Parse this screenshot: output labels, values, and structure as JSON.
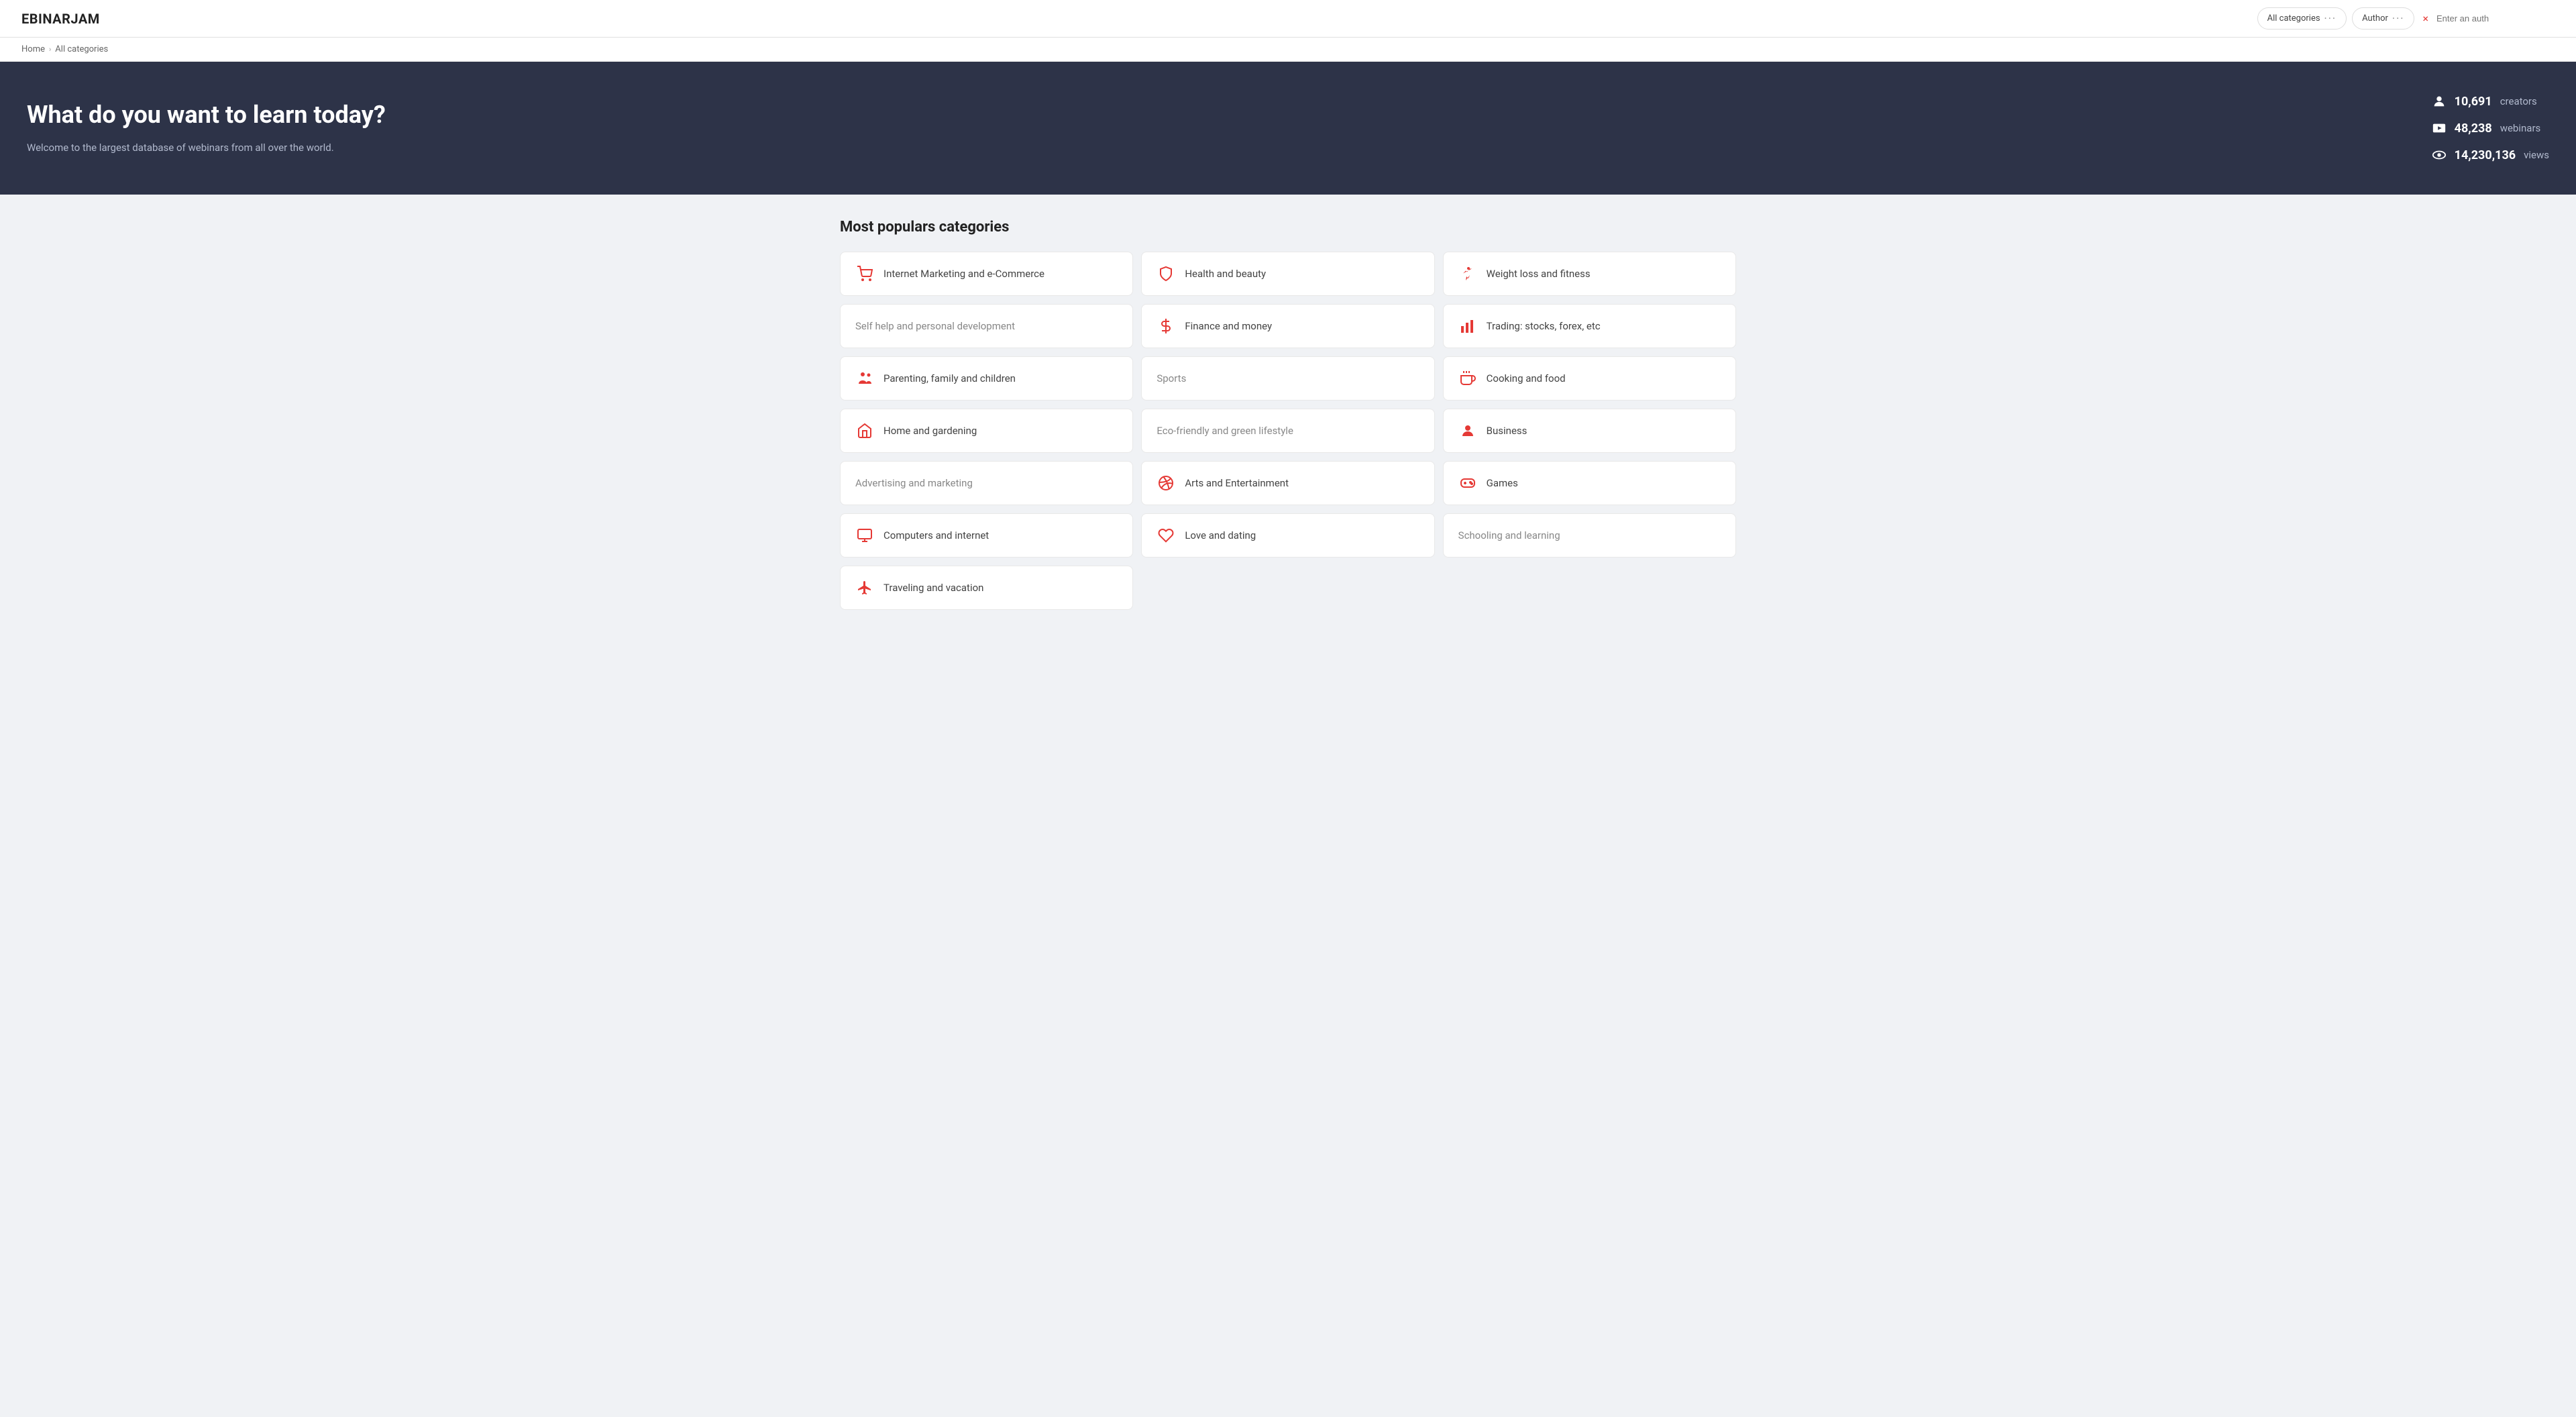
{
  "header": {
    "logo": "EBINARJAM",
    "filter1_label": "All categories",
    "filter2_label": "Author",
    "author_placeholder": "Enter an auth",
    "close_label": "×"
  },
  "breadcrumb": {
    "home": "Home",
    "sep": "^",
    "current": "All categories"
  },
  "hero": {
    "title": "What do you want to learn today?",
    "subtitle": "Welcome to the largest database of webinars from all over the world.",
    "stats": [
      {
        "number": "10,691",
        "label": "creators",
        "icon": "person"
      },
      {
        "number": "48,238",
        "label": "webinars",
        "icon": "video"
      },
      {
        "number": "14,230,136",
        "label": "views",
        "icon": "eye"
      }
    ]
  },
  "section_title": "Most populars categories",
  "categories": [
    {
      "label": "Internet Marketing and e-Commerce",
      "icon": "cart",
      "hasIcon": true
    },
    {
      "label": "Health and beauty",
      "icon": "shield",
      "hasIcon": true
    },
    {
      "label": "Weight loss and fitness",
      "icon": "run",
      "hasIcon": true
    },
    {
      "label": "Self help and personal development",
      "icon": "none",
      "hasIcon": false
    },
    {
      "label": "Finance and money",
      "icon": "dollar",
      "hasIcon": true
    },
    {
      "label": "Trading: stocks, forex, etc",
      "icon": "chart",
      "hasIcon": true
    },
    {
      "label": "Parenting, family and children",
      "icon": "family",
      "hasIcon": true
    },
    {
      "label": "Sports",
      "icon": "none",
      "hasIcon": false
    },
    {
      "label": "Cooking and food",
      "icon": "food",
      "hasIcon": true
    },
    {
      "label": "Home and gardening",
      "icon": "house",
      "hasIcon": true
    },
    {
      "label": "Eco-friendly and green lifestyle",
      "icon": "none",
      "hasIcon": false
    },
    {
      "label": "Business",
      "icon": "business",
      "hasIcon": true
    },
    {
      "label": "Advertising and marketing",
      "icon": "none",
      "hasIcon": false
    },
    {
      "label": "Arts and Entertainment",
      "icon": "arts",
      "hasIcon": true
    },
    {
      "label": "Games",
      "icon": "games",
      "hasIcon": true
    },
    {
      "label": "Computers and internet",
      "icon": "computer",
      "hasIcon": true
    },
    {
      "label": "Love and dating",
      "icon": "heart",
      "hasIcon": true
    },
    {
      "label": "Schooling and learning",
      "icon": "none",
      "hasIcon": false
    },
    {
      "label": "Traveling and vacation",
      "icon": "travel",
      "hasIcon": true
    }
  ],
  "colors": {
    "icon_red": "#e53935",
    "hero_bg": "#2d3348"
  }
}
